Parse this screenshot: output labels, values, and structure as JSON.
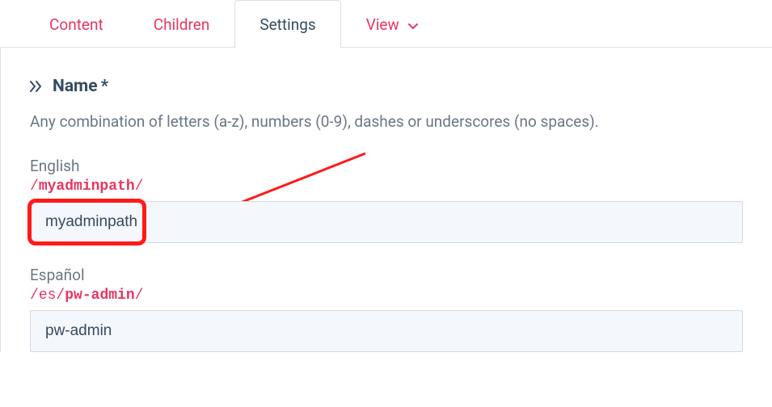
{
  "tabs": {
    "content": "Content",
    "children": "Children",
    "settings": "Settings",
    "view": "View"
  },
  "field": {
    "title": "Name",
    "required_mark": "*",
    "description": "Any combination of letters (a-z), numbers (0-9), dashes or underscores (no spaces)."
  },
  "langs": [
    {
      "label": "English",
      "path_seg_light": "",
      "path_seg_bold": "myadminpath",
      "value": "myadminpath"
    },
    {
      "label": "Español",
      "path_seg_light": "es",
      "path_seg_bold": "pw-admin",
      "value": "pw-admin"
    }
  ]
}
